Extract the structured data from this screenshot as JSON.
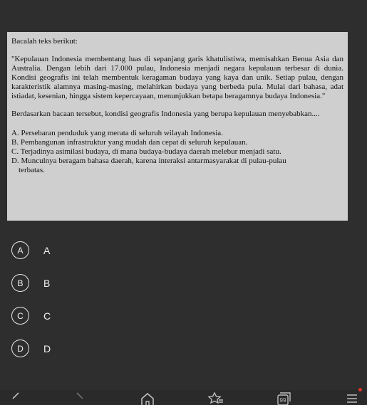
{
  "question": {
    "heading": "Bacalah teks berikut:",
    "passage": "\"Kepulauan Indonesia membentang luas di sepanjang garis khatulistiwa, memisahkan Benua Asia dan Australia. Dengan lebih dari 17.000 pulau, Indonesia menjadi negara kepulauan terbesar di dunia. Kondisi geografis ini telah membentuk keragaman budaya yang kaya dan unik. Setiap pulau, dengan karakteristik alamnya masing-masing, melahirkan budaya yang berbeda pula. Mulai dari bahasa, adat istiadat, kesenian, hingga sistem kepercayaan, menunjukkan betapa beragamnya budaya Indonesia.\"",
    "prompt": "Berdasarkan bacaan tersebut, kondisi geografis Indonesia yang berupa kepulauan menyebabkan....",
    "options": [
      "A. Persebaran penduduk yang merata di seluruh wilayah Indonesia.",
      "B. Pembangunan infrastruktur yang mudah dan cepat di seluruh kepulauan.",
      "C. Terjadinya asimilasi budaya, di mana budaya-budaya daerah melebur menjadi satu.",
      "D. Munculnya beragam bahasa daerah, karena interaksi antarmasyarakat di pulau-pulau"
    ],
    "option_d_continuation": "terbatas."
  },
  "answers": [
    {
      "letter": "A",
      "label": "A"
    },
    {
      "letter": "B",
      "label": "B"
    },
    {
      "letter": "C",
      "label": "C"
    },
    {
      "letter": "D",
      "label": "D"
    }
  ],
  "bottom_nav": {
    "icons": [
      "back-icon",
      "forward-icon",
      "home-icon",
      "bookmark-icon",
      "tabs-icon",
      "menu-icon"
    ],
    "tab_count": "99",
    "icon_color": "#bdbdbd",
    "notification_color": "#e0352b"
  }
}
